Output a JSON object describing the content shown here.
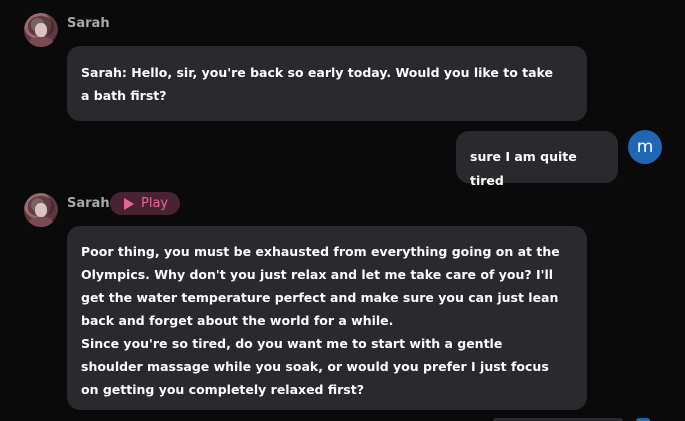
{
  "messages": [
    {
      "sender": "Sarah",
      "text": "Sarah: Hello, sir, you're back so early today. Would you like to take a bath first?"
    },
    {
      "sender": "user",
      "avatar_letter": "m",
      "text": "sure I am quite tired"
    },
    {
      "sender": "Sarah",
      "play_label": "Play",
      "paragraph1": "Poor thing, you must be exhausted from everything going on at the Olympics. Why don't you just relax and let me take care of you? I'll get the water temperature perfect and make sure you can just lean back and forget about the world for a while.",
      "paragraph2": "Since you're so tired, do you want me to start with a gentle shoulder massage while you soak, or would you prefer I just focus on getting you completely relaxed first?"
    }
  ],
  "colors": {
    "background": "#0a0a0b",
    "bubble": "#2a2a2e",
    "name": "#a8a8ad",
    "play_pill_bg": "#4a2333",
    "play_accent": "#e8659a",
    "user_avatar": "#1f67b5"
  },
  "icons": {
    "play": "play-triangle-icon"
  }
}
